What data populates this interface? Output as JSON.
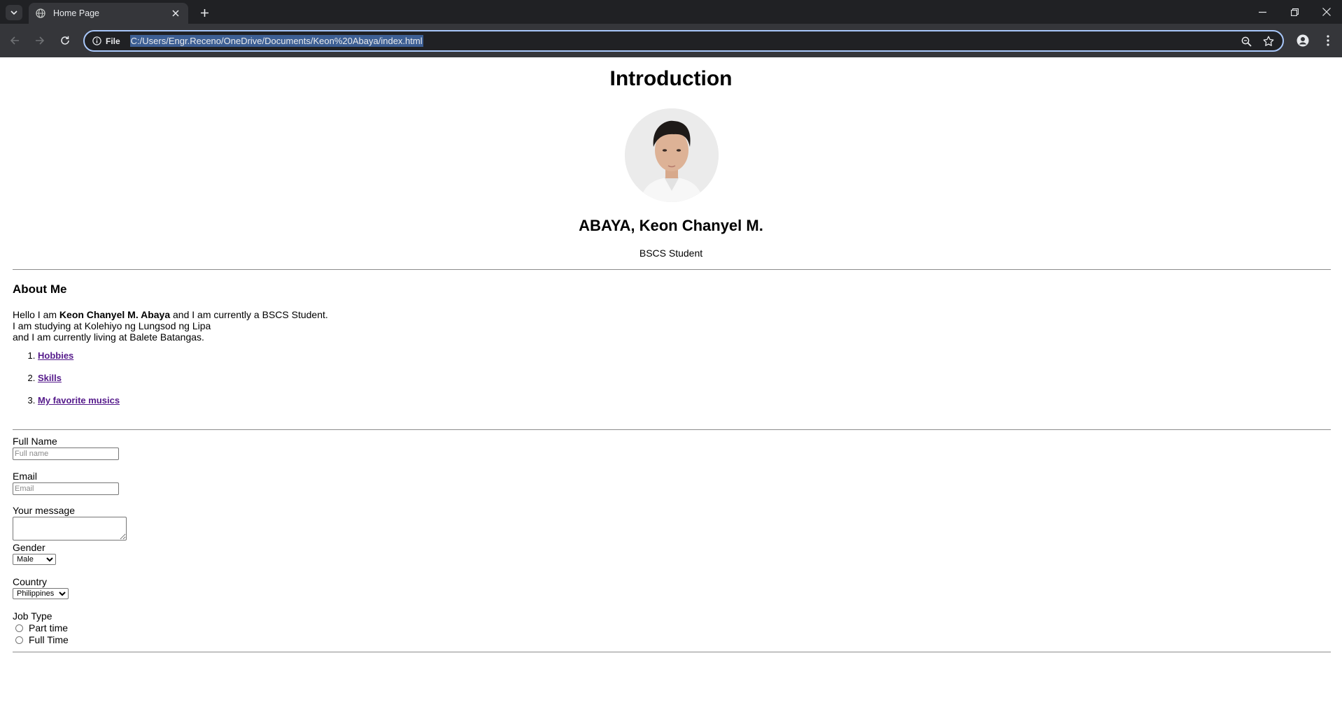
{
  "browser": {
    "tab_title": "Home Page",
    "omnibox_scheme": "File",
    "url": "C:/Users/Engr.Receno/OneDrive/Documents/Keon%20Abaya/index.html"
  },
  "page": {
    "heading": "Introduction",
    "name": "ABAYA, Keon Chanyel M.",
    "role": "BSCS Student",
    "about": {
      "heading": "About Me",
      "line1_pre": "Hello I am ",
      "line1_bold": "Keon Chanyel M. Abaya",
      "line1_post": " and I am currently a BSCS Student.",
      "line2": "I am studying at Kolehiyo ng Lungsod ng Lipa",
      "line3": "and I am currently living at Balete Batangas.",
      "links": [
        "Hobbies",
        "Skills",
        "My favorite musics"
      ]
    },
    "form": {
      "full_name_label": "Full Name",
      "full_name_placeholder": "Full name",
      "email_label": "Email",
      "email_placeholder": "Email",
      "message_label": "Your message",
      "gender_label": "Gender",
      "gender_value": "Male",
      "country_label": "Country",
      "country_value": "Philippines",
      "job_type_label": "Job Type",
      "job_options": [
        "Part time",
        "Full Time"
      ]
    }
  },
  "colors": {
    "chrome_dark": "#202124",
    "toolbar": "#35363a",
    "omnibox_focus": "#a8c7fa",
    "visited_link": "#551a8b"
  }
}
